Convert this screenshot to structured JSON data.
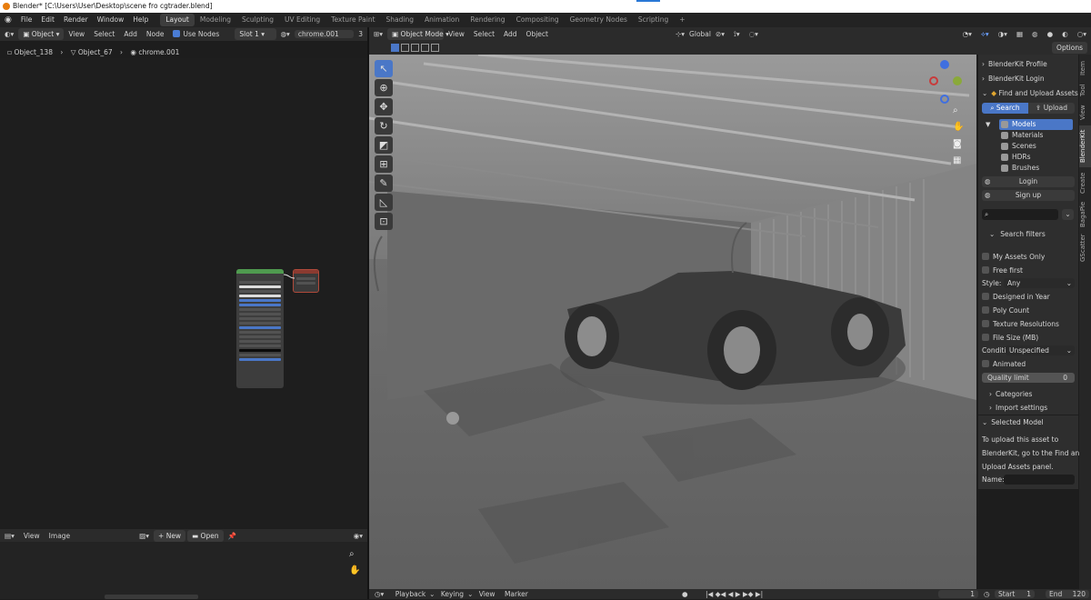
{
  "title_bar": {
    "text": "Blender* [C:\\Users\\User\\Desktop\\scene fro cgtrader.blend]"
  },
  "top_menu": [
    "File",
    "Edit",
    "Render",
    "Window",
    "Help"
  ],
  "workspaces": [
    {
      "label": "Layout",
      "active": true
    },
    {
      "label": "Modeling"
    },
    {
      "label": "Sculpting"
    },
    {
      "label": "UV Editing"
    },
    {
      "label": "Texture Paint"
    },
    {
      "label": "Shading"
    },
    {
      "label": "Animation"
    },
    {
      "label": "Rendering"
    },
    {
      "label": "Compositing"
    },
    {
      "label": "Geometry Nodes"
    },
    {
      "label": "Scripting"
    }
  ],
  "add_workspace": "+",
  "node_editor": {
    "object_select": "Object",
    "menus": [
      "View",
      "Select",
      "Add",
      "Node"
    ],
    "use_nodes": "Use Nodes",
    "slot": "Slot 1",
    "material": "chrome.001",
    "material_users": "3",
    "breadcrumb": [
      "Object_138",
      "Object_67",
      "chrome.001"
    ]
  },
  "image_editor": {
    "menus": [
      "View",
      "Image"
    ],
    "new_label": "New",
    "open_label": "Open"
  },
  "viewport": {
    "mode": "Object Mode",
    "menus": [
      "View",
      "Select",
      "Add",
      "Object"
    ],
    "transform_orientation": "Global",
    "options": "Options"
  },
  "blenderkit_panel": {
    "profile": "BlenderKit Profile",
    "login_header": "BlenderKit Login",
    "find_upload": "Find and Upload Assets",
    "search_tab": "Search",
    "upload_tab": "Upload",
    "categories": [
      "Models",
      "Materials",
      "Scenes",
      "HDRs",
      "Brushes"
    ],
    "login_btn": "Login",
    "signup_btn": "Sign up",
    "search_filters": "Search filters",
    "my_assets_only": "My Assets Only",
    "free_first": "Free first",
    "style_label": "Style:",
    "style_value": "Any",
    "designed_in_year": "Designed in Year",
    "poly_count": "Poly Count",
    "texture_resolutions": "Texture Resolutions",
    "file_size": "File Size (MB)",
    "condition_label": "Conditi...",
    "condition_value": "Unspecified",
    "animated": "Animated",
    "quality_limit_label": "Quality limit",
    "quality_limit_value": "0",
    "categories_section": "Categories",
    "import_settings": "Import settings",
    "selected_model": "Selected Model",
    "upload_help_1": "To upload this asset to",
    "upload_help_2": "BlenderKit, go to the Find and",
    "upload_help_3": "Upload Assets panel.",
    "name_label": "Name:"
  },
  "side_tabs": [
    "Item",
    "Tool",
    "View",
    "BlenderKit",
    "Create",
    "BagaPie",
    "GScatter"
  ],
  "timeline": {
    "menus": [
      "Playback",
      "Keying",
      "View",
      "Marker"
    ],
    "current_frame": "1",
    "start_label": "Start",
    "start_value": "1",
    "end_label": "End",
    "end_value": "120"
  },
  "colors": {
    "accent": "#4a77c7",
    "active_ws": "#3d3d3d",
    "panel": "#2e2e2e",
    "viewport": "#6e6e6e"
  }
}
